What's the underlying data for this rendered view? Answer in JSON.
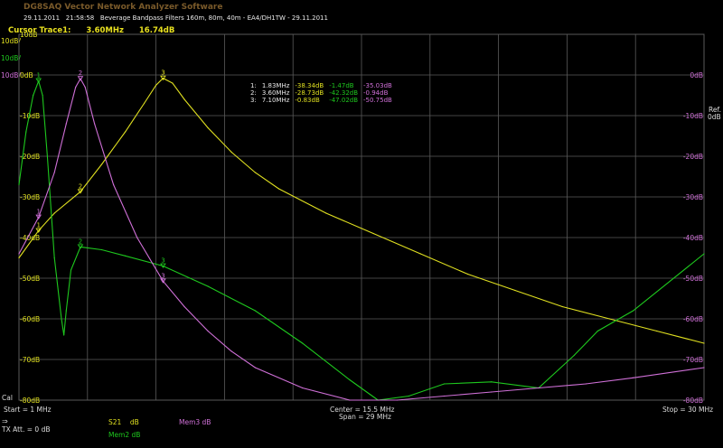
{
  "app": {
    "title": "DG8SAQ Vector Network Analyzer Software",
    "date": "29.11.2011",
    "time": "21:58:58",
    "description": "Beverage Bandpass Filters 160m, 80m, 40m - EA4/DH1TW - 29.11.2011",
    "cursor_label": "Cursor Trace1:",
    "cursor_freq": "3.60MHz",
    "cursor_value": "16.74dB"
  },
  "scale_labels": {
    "left_top": [
      "10dB/",
      "10dB/",
      "10dB/"
    ],
    "right_ref": "Ref.",
    "right_ref_db": "0dB"
  },
  "colors": {
    "yellow": "#e0e020",
    "green": "#1ec81e",
    "violet": "#d070d8",
    "grid": "#5a5a5a",
    "bg": "#000000"
  },
  "footer": {
    "start": "Start = 1 MHz",
    "center": "Center = 15.5 MHz",
    "span": "Span = 29 MHz",
    "stop": "Stop = 30 MHz",
    "cal": "Cal",
    "tx": "TX Att. = 0 dB",
    "arrow": "⇒"
  },
  "legend": {
    "s21": "S21",
    "s21_unit": "dB",
    "mem3": "Mem3 dB",
    "mem2": "Mem2 dB"
  },
  "markers": [
    {
      "n": "1:",
      "freq": "1.83MHz",
      "yellow": "-38.34dB",
      "green": "-1.47dB",
      "violet": "-35.03dB"
    },
    {
      "n": "2:",
      "freq": "3.60MHz",
      "yellow": "-28.73dB",
      "green": "-42.32dB",
      "violet": "-0.94dB"
    },
    {
      "n": "3:",
      "freq": "7.10MHz",
      "yellow": "-0.83dB",
      "green": "-47.02dB",
      "violet": "-50.75dB"
    }
  ],
  "chart_data": {
    "type": "line",
    "xlabel": "",
    "ylabel": "",
    "xlim": [
      1,
      30
    ],
    "ylim": [
      -80,
      10
    ],
    "x_unit": "MHz",
    "y_ticks": [
      10,
      0,
      -10,
      -20,
      -30,
      -40,
      -50,
      -60,
      -70,
      -80
    ],
    "y_tick_labels_left": [
      "10dB",
      "0dB",
      "-10dB",
      "-20dB",
      "-30dB",
      "-40dB",
      "-50dB",
      "-60dB",
      "-70dB",
      "-80dB"
    ],
    "y_tick_labels_right": [
      "10dB",
      "0dB",
      "-10dB",
      "-20dB",
      "-30dB",
      "-40dB",
      "-50dB",
      "-60dB",
      "-70dB",
      "-80dB"
    ],
    "grid": true,
    "series": [
      {
        "name": "S21",
        "color": "#e0e020",
        "x": [
          1,
          1.83,
          2.5,
          3.6,
          4.5,
          5.5,
          6.3,
          6.8,
          7.1,
          7.5,
          8,
          9,
          10,
          11,
          12,
          14,
          16,
          18,
          20,
          22,
          24,
          26,
          28,
          30
        ],
        "y": [
          -45,
          -38.3,
          -34,
          -28.7,
          -22,
          -14,
          -7,
          -2.5,
          -0.8,
          -2,
          -6,
          -13,
          -19,
          -24,
          -28,
          -34,
          -39,
          -44,
          -49,
          -53,
          -57,
          -60,
          -63,
          -66
        ]
      },
      {
        "name": "Mem2",
        "color": "#1ec81e",
        "x": [
          1,
          1.3,
          1.6,
          1.83,
          2.0,
          2.2,
          2.5,
          2.8,
          2.9,
          3.0,
          3.2,
          3.6,
          4.5,
          5.5,
          7.1,
          9,
          11,
          13,
          15,
          16.2,
          17.5,
          19,
          21,
          23,
          24.5,
          25.5,
          27,
          30
        ],
        "y": [
          -27,
          -14,
          -5,
          -1.5,
          -5,
          -20,
          -45,
          -60,
          -64,
          -58,
          -48,
          -42.3,
          -43,
          -44.5,
          -47,
          -52,
          -58,
          -66,
          -75,
          -80,
          -79,
          -76,
          -75.5,
          -77,
          -69,
          -63,
          -58,
          -44
        ]
      },
      {
        "name": "Mem3",
        "color": "#d070d8",
        "x": [
          1,
          1.83,
          2.5,
          3.0,
          3.4,
          3.6,
          3.8,
          4.2,
          5,
          6,
          7.1,
          8,
          9,
          10,
          11,
          13,
          15,
          17,
          19,
          21,
          23,
          25,
          27,
          30
        ],
        "y": [
          -44,
          -35,
          -24,
          -12,
          -3,
          -0.9,
          -3,
          -12,
          -27,
          -40,
          -50.7,
          -57,
          -63,
          -68,
          -72,
          -77,
          -80,
          -80,
          -79,
          -78,
          -77,
          -76,
          -74.5,
          -72
        ]
      }
    ],
    "marker_points": [
      {
        "series": "S21",
        "x": [
          1.83,
          3.6,
          7.1
        ],
        "y": [
          -38.34,
          -28.73,
          -0.83
        ]
      },
      {
        "series": "Mem2",
        "x": [
          1.83,
          3.6,
          7.1
        ],
        "y": [
          -1.47,
          -42.32,
          -47.02
        ]
      },
      {
        "series": "Mem3",
        "x": [
          1.83,
          3.6,
          7.1
        ],
        "y": [
          -35.03,
          -0.94,
          -50.75
        ]
      }
    ]
  }
}
